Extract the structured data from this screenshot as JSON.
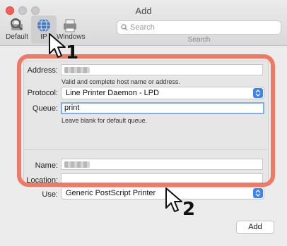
{
  "window": {
    "title": "Add"
  },
  "toolbar": {
    "items": [
      {
        "label": "Default",
        "icon": "default-printer-icon"
      },
      {
        "label": "IP",
        "icon": "ip-globe-icon"
      },
      {
        "label": "Windows",
        "icon": "windows-printer-icon"
      }
    ],
    "search_placeholder": "Search",
    "search_label": "Search"
  },
  "form": {
    "address_label": "Address:",
    "address_value": "",
    "address_hint": "Valid and complete host name or address.",
    "protocol_label": "Protocol:",
    "protocol_value": "Line Printer Daemon - LPD",
    "queue_label": "Queue:",
    "queue_value": "print",
    "queue_hint": "Leave blank for default queue.",
    "name_label": "Name:",
    "name_value": "",
    "location_label": "Location:",
    "location_value": "",
    "use_label": "Use:",
    "use_value": "Generic PostScript Printer"
  },
  "buttons": {
    "add": "Add"
  },
  "annotations": {
    "step1": "1",
    "step2": "2"
  },
  "colors": {
    "highlight": "#ee7a66",
    "accent": "#3f82f6",
    "focus": "#7aaef5"
  }
}
